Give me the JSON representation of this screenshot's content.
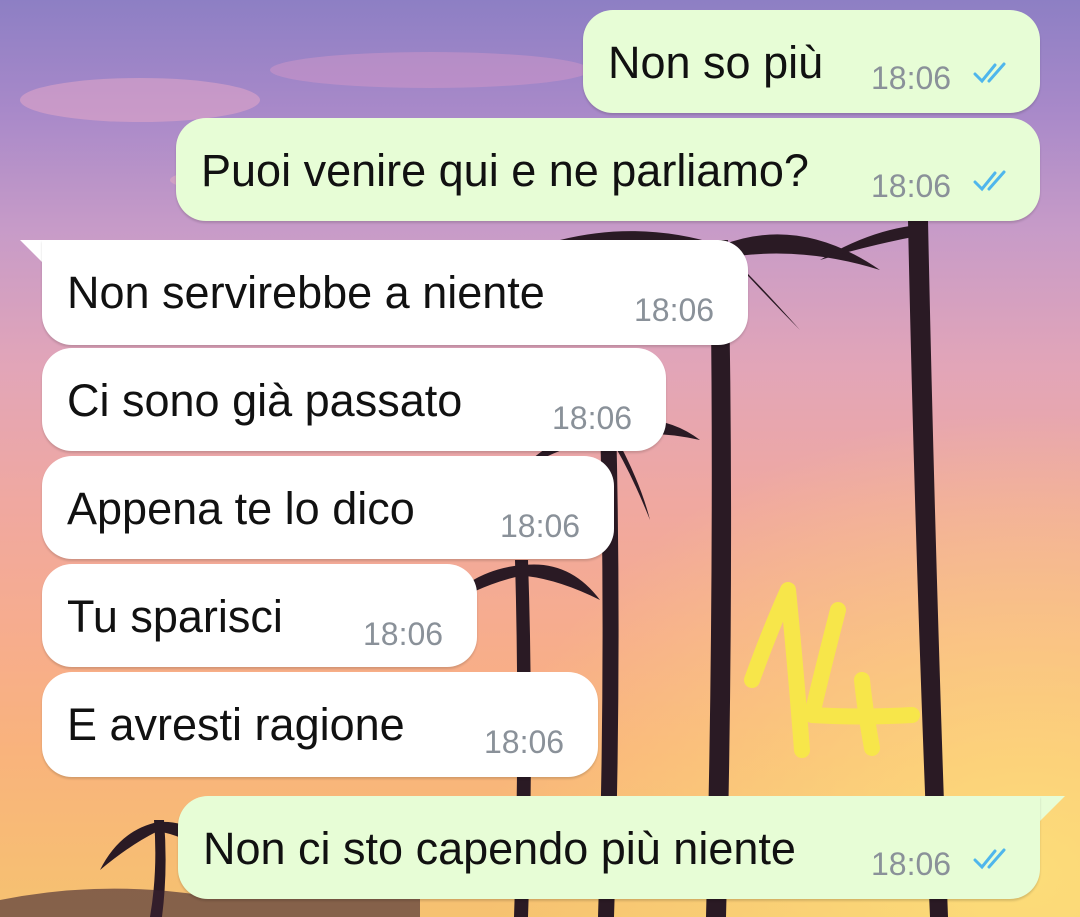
{
  "messages": [
    {
      "direction": "out",
      "text": "Non so più",
      "time": "18:06",
      "status": "read"
    },
    {
      "direction": "out",
      "text": "Puoi venire qui e ne parliamo?",
      "time": "18:06",
      "status": "read"
    },
    {
      "direction": "in",
      "text": "Non servirebbe a niente",
      "time": "18:06"
    },
    {
      "direction": "in",
      "text": "Ci sono già passato",
      "time": "18:06"
    },
    {
      "direction": "in",
      "text": "Appena te lo dico",
      "time": "18:06"
    },
    {
      "direction": "in",
      "text": "Tu sparisci",
      "time": "18:06"
    },
    {
      "direction": "in",
      "text": "E avresti ragione",
      "time": "18:06"
    },
    {
      "direction": "out",
      "text": "Non ci sto capendo più niente",
      "time": "18:06",
      "status": "read"
    }
  ],
  "annotation": {
    "text": "14",
    "color": "#f7e64a"
  },
  "colors": {
    "outgoing_bubble": "#e7fdd6",
    "incoming_bubble": "#ffffff",
    "read_ticks": "#4fb6ec",
    "timestamp": "#8a9199"
  },
  "icons": {
    "read_receipt": "double-check-icon"
  }
}
